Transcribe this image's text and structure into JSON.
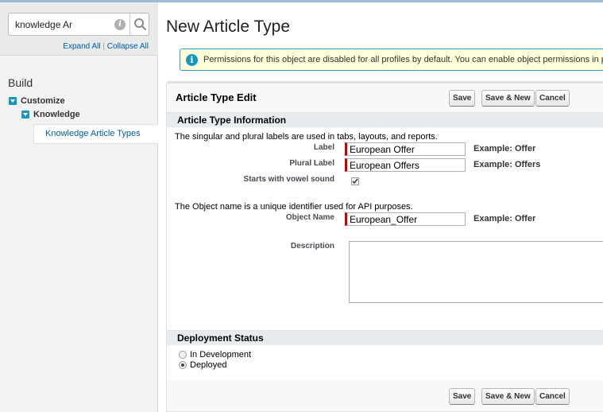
{
  "sidebar": {
    "search_value": "knowledge Ar",
    "expand_all": "Expand All",
    "separator": "|",
    "collapse_all": "Collapse All",
    "build_title": "Build",
    "tree": {
      "customize": "Customize",
      "knowledge": "Knowledge",
      "knowledge_article_types": "Knowledge Article Types"
    }
  },
  "page": {
    "title": "New Article Type",
    "banner_text": "Permissions for this object are disabled for all profiles by default. You can enable object permissions in perm"
  },
  "panel": {
    "title": "Article Type Edit",
    "buttons": {
      "save": "Save",
      "save_new": "Save & New",
      "cancel": "Cancel"
    },
    "section_info": {
      "title": "Article Type Information",
      "note1": "The singular and plural labels are used in tabs, layouts, and reports.",
      "label_label": "Label",
      "label_value": "European Offer",
      "label_example": "Example:  Offer",
      "plural_label": "Plural Label",
      "plural_value": "European Offers",
      "plural_example": "Example:  Offers",
      "vowel_label": "Starts with vowel sound",
      "vowel_checked": true,
      "note2": "The Object name is a unique identifier used for API purposes.",
      "object_name_label": "Object Name",
      "object_name_value": "European_Offer",
      "object_name_example": "Example:  Offer",
      "description_label": "Description",
      "description_value": ""
    },
    "section_deploy": {
      "title": "Deployment Status",
      "options": [
        "In Development",
        "Deployed"
      ],
      "selected": "Deployed"
    }
  },
  "colors": {
    "accent": "#1797c0",
    "required": "#cc0000",
    "banner_bg": "#ffffdc",
    "link": "#015ba7"
  }
}
